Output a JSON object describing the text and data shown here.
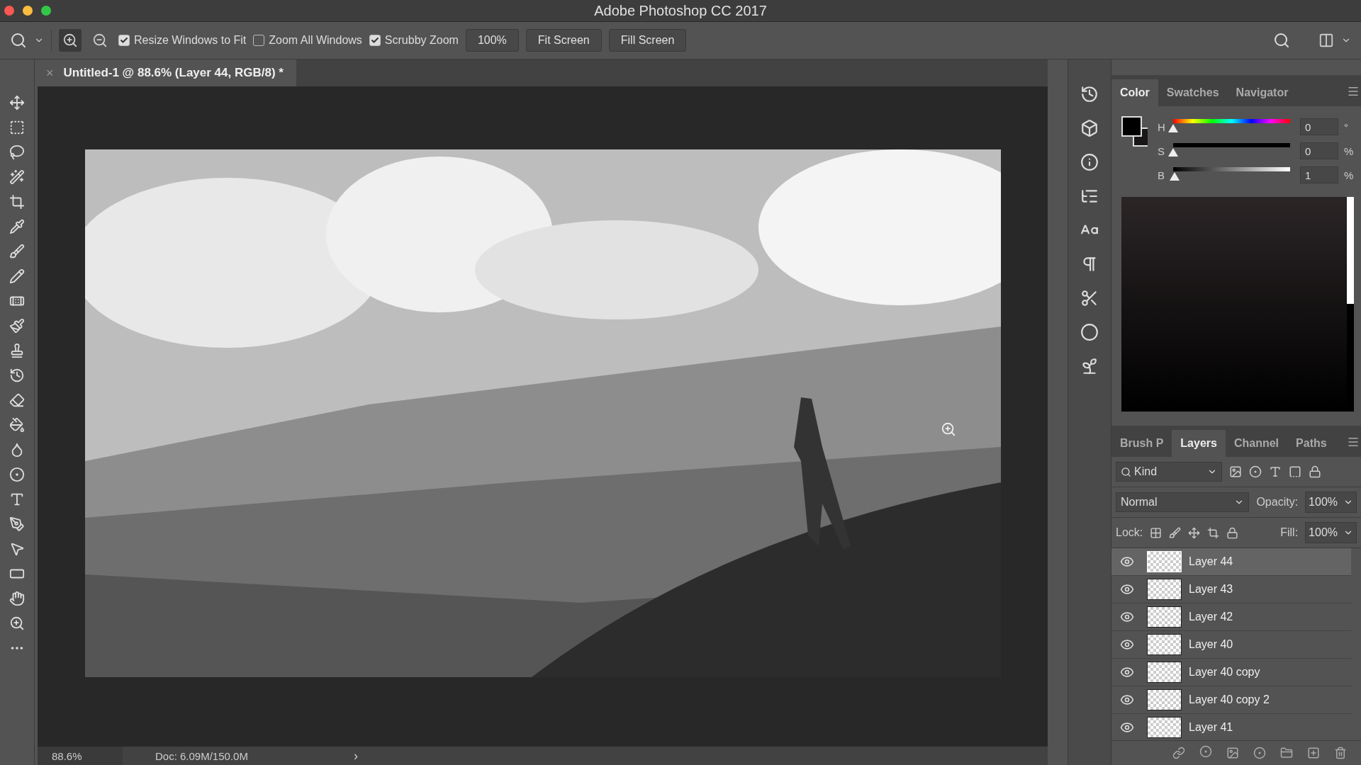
{
  "window": {
    "title": "Adobe Photoshop CC 2017"
  },
  "options_bar": {
    "checkboxes": [
      {
        "label": "Resize Windows to Fit",
        "checked": true
      },
      {
        "label": "Zoom All Windows",
        "checked": false
      },
      {
        "label": "Scrubby Zoom",
        "checked": true
      }
    ],
    "zoom_value": "100%",
    "buttons": [
      "Fit Screen",
      "Fill Screen"
    ]
  },
  "document": {
    "close": "×",
    "title": "Untitled-1 @ 88.6% (Layer 44, RGB/8) *"
  },
  "status_bar": {
    "zoom": "88.6%",
    "doc": "Doc: 6.09M/150.0M",
    "arrow": "›"
  },
  "color_panel": {
    "tabs": [
      {
        "label": "Color",
        "selected": true
      },
      {
        "label": "Swatches",
        "selected": false
      },
      {
        "label": "Navigator",
        "selected": false
      }
    ],
    "sliders": [
      {
        "kind": "hue",
        "label": "H",
        "level": 0,
        "value": "0",
        "unit": "°"
      },
      {
        "kind": "saturation",
        "label": "S",
        "level": 0,
        "value": "0",
        "unit": "%"
      },
      {
        "kind": "brightness",
        "label": "B",
        "level": 0.01,
        "value": "1",
        "unit": "%"
      }
    ]
  },
  "layers_panel": {
    "tabs": [
      {
        "label": "Brush P",
        "selected": false
      },
      {
        "label": "Layers",
        "selected": true
      },
      {
        "label": "Channel",
        "selected": false
      },
      {
        "label": "Paths",
        "selected": false
      }
    ],
    "filter": "Kind",
    "blend_mode": "Normal",
    "opacity_label": "Opacity:",
    "opacity": "100%",
    "lock_label": "Lock:",
    "fill_label": "Fill:",
    "fill": "100%",
    "layers": [
      {
        "name": "Layer 44",
        "visible": true,
        "selected": true
      },
      {
        "name": "Layer 43",
        "visible": true,
        "selected": false
      },
      {
        "name": "Layer 42",
        "visible": true,
        "selected": false
      },
      {
        "name": "Layer 40",
        "visible": true,
        "selected": false
      },
      {
        "name": "Layer 40 copy",
        "visible": true,
        "selected": false
      },
      {
        "name": "Layer 40 copy 2",
        "visible": true,
        "selected": false
      },
      {
        "name": "Layer 41",
        "visible": true,
        "selected": false
      }
    ]
  }
}
